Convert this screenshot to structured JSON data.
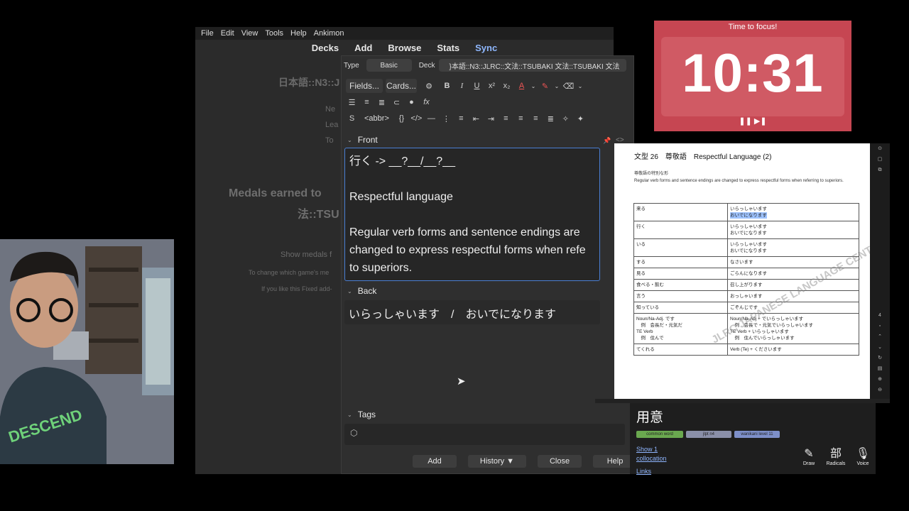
{
  "anki_main": {
    "menu": [
      "File",
      "Edit",
      "View",
      "Tools",
      "Help",
      "Ankimon"
    ],
    "nav": [
      "Decks",
      "Add",
      "Browse",
      "Stats",
      "Sync"
    ],
    "bg_deck_title": "日本語::N3::J",
    "bg_stats": [
      "Ne",
      "Lea",
      "To"
    ],
    "bg_medals_1": "Medals earned to",
    "bg_medals_2": "法::TSU",
    "bg_show_medals": "Show medals f",
    "bg_change_game": "To change which game's me",
    "bg_fixed_addon": "If you like this Fixed add-"
  },
  "add_dialog": {
    "type_label": "Type",
    "type_value": "Basic",
    "deck_label": "Deck",
    "deck_value": "}本語::N3::JLRC::文法::TSUBAKI 文法::TSUBAKI 文法",
    "fields_button": "Fields...",
    "cards_button": "Cards...",
    "abbr_button": "<abbr>",
    "front_label": "Front",
    "front_lines": [
      "行く -> __?__/__?__",
      "",
      "Respectful language",
      "",
      "Regular verb forms and sentence endings are",
      "changed to express respectful forms when refe",
      "to superiors."
    ],
    "back_label": "Back",
    "back_value": "いらっしゃいます　/　おいでになります",
    "tags_label": "Tags",
    "buttons": {
      "add": "Add",
      "history": "History ▼",
      "close": "Close",
      "help": "Help"
    }
  },
  "timer": {
    "title": "Time to focus!",
    "time": "10:31",
    "controls": "❚❚ ▶❚",
    "bg_color": "#c64652"
  },
  "pdf": {
    "title": "文型 26　尊敬語　Respectful Language (2)",
    "subtitle": "尊敬語の特別な形",
    "description": "Regular verb forms and sentence endings are changed to express respectful forms when referring to superiors.",
    "watermark": "JLRC JAPANESE LANGUAGE CENTER",
    "rows": [
      {
        "left": [
          "来る"
        ],
        "right": [
          "いらっしゃいます",
          "おいでになります"
        ]
      },
      {
        "left": [
          "行く"
        ],
        "right": [
          "いらっしゃいます",
          "おいでになります"
        ]
      },
      {
        "left": [
          "いる"
        ],
        "right": [
          "いらっしゃいます",
          "おいでになります"
        ]
      },
      {
        "left": [
          "する"
        ],
        "right": [
          "なさいます"
        ]
      },
      {
        "left": [
          "見る"
        ],
        "right": [
          "ごらんになります"
        ]
      },
      {
        "left": [
          "食べる・飲む"
        ],
        "right": [
          "召し上がります"
        ]
      },
      {
        "left": [
          "言う"
        ],
        "right": [
          "おっしゃいます"
        ]
      },
      {
        "left": [
          "知っている"
        ],
        "right": [
          "ごぞんじです"
        ]
      },
      {
        "left": [
          "Noun/Na-Adj. です",
          "　例　会長だ・元気だ",
          "TE Verb",
          "　例　住んで"
        ],
        "right": [
          "Noun/Na-Adj + でいらっしゃいます",
          "　例　会長で・元気でいらっしゃいます",
          "TE Verb + いらっしゃいます",
          "　例　住んでいらっしゃいます"
        ]
      },
      {
        "left": [
          "てくれる"
        ],
        "right": [
          "Verb (Te) + くださいます"
        ]
      }
    ],
    "highlighted": "おいでになります",
    "sidebar_icons": [
      "⊙",
      "▢",
      "⧉",
      "4",
      "▫",
      "⌃",
      "⌄",
      "↻",
      "▤",
      "⊕",
      "⊖"
    ]
  },
  "dictionary": {
    "word": "用意",
    "tags": [
      "common word",
      "jlpt n4",
      "wanikani level 11"
    ],
    "show_link": "Show 1",
    "collocation_link": "collocation",
    "links_text": "Links",
    "tools": [
      {
        "glyph": "✎",
        "label": "Draw"
      },
      {
        "glyph": "部",
        "label": "Radicals"
      },
      {
        "glyph": "🎙",
        "label": "Voice"
      }
    ]
  }
}
